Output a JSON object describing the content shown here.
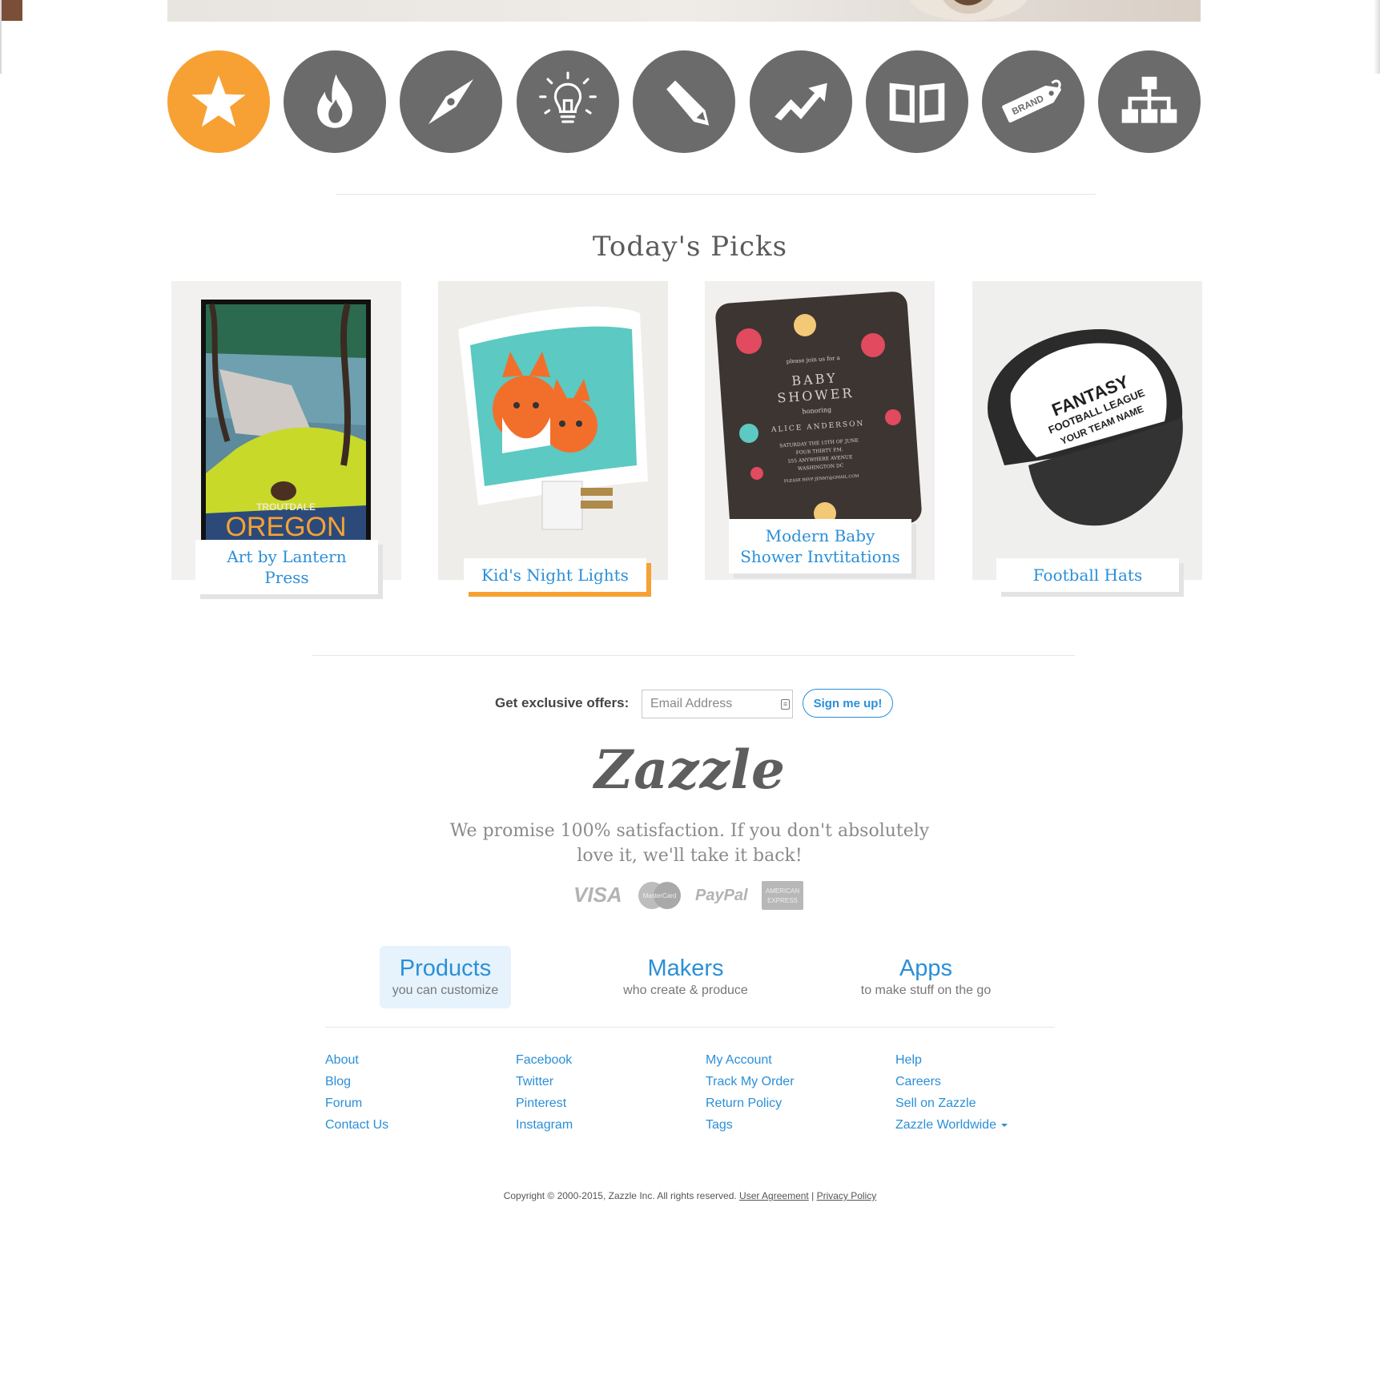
{
  "category_nav": {
    "items": [
      {
        "icon": "star-icon",
        "active": true
      },
      {
        "icon": "flame-icon",
        "active": false
      },
      {
        "icon": "compass-icon",
        "active": false
      },
      {
        "icon": "lightbulb-icon",
        "active": false
      },
      {
        "icon": "pencil-icon",
        "active": false
      },
      {
        "icon": "trending-icon",
        "active": false
      },
      {
        "icon": "book-icon",
        "active": false
      },
      {
        "icon": "brand-tag-icon",
        "active": false
      },
      {
        "icon": "sitemap-icon",
        "active": false
      }
    ],
    "brand_tag_text": "BRAND",
    "colors": {
      "active": "#f7a134",
      "inactive": "#6b6b6b"
    }
  },
  "todays_picks": {
    "title": "Today's Picks",
    "items": [
      {
        "label": "Art by Lantern Press",
        "poster_top": "TROUTDALE",
        "poster_main": "OREGON",
        "active": false
      },
      {
        "label": "Kid's Night Lights",
        "active": true
      },
      {
        "label": "Modern Baby Shower Invtitations",
        "card_lines": [
          "please join us for a",
          "BABY",
          "SHOWER",
          "honoring",
          "ALICE ANDERSON",
          "SATURDAY THE 15TH OF JUNE",
          "FOUR THIRTY P.M.",
          "555 ANYWHERE AVENUE",
          "WASHINGTON DC",
          "PLEASE RSVP JENNY@GMAIL.COM"
        ],
        "active": false
      },
      {
        "label": "Football Hats",
        "hat_lines": [
          "FANTASY",
          "FOOTBALL LEAGUE",
          "YOUR TEAM NAME"
        ],
        "active": false
      }
    ]
  },
  "newsletter": {
    "label": "Get exclusive offers:",
    "email_placeholder": "Email Address",
    "button": "Sign me up!"
  },
  "brand": {
    "logo": "Zazzle",
    "promise": "We promise 100% satisfaction. If you don't absolutely love it, we'll take it back!"
  },
  "payments": {
    "visa": "VISA",
    "mastercard": "MasterCard",
    "paypal": "PayPal",
    "amex": "AMERICAN EXPRESS"
  },
  "footer_tabs": [
    {
      "title": "Products",
      "subtitle": "you can customize",
      "active": true
    },
    {
      "title": "Makers",
      "subtitle": "who create & produce",
      "active": false
    },
    {
      "title": "Apps",
      "subtitle": "to make stuff on the go",
      "active": false
    }
  ],
  "footer_links": {
    "col1": [
      "About",
      "Blog",
      "Forum",
      "Contact Us"
    ],
    "col2": [
      "Facebook",
      "Twitter",
      "Pinterest",
      "Instagram"
    ],
    "col3": [
      "My Account",
      "Track My Order",
      "Return Policy",
      "Tags"
    ],
    "col4": [
      "Help",
      "Careers",
      "Sell on Zazzle",
      "Zazzle Worldwide"
    ]
  },
  "copyright": {
    "text": "Copyright © 2000-2015, Zazzle Inc. All rights reserved.",
    "user_agreement": "User Agreement",
    "separator": "|",
    "privacy": "Privacy Policy"
  },
  "colors": {
    "link": "#2a8fd8",
    "accent": "#f7a134"
  }
}
